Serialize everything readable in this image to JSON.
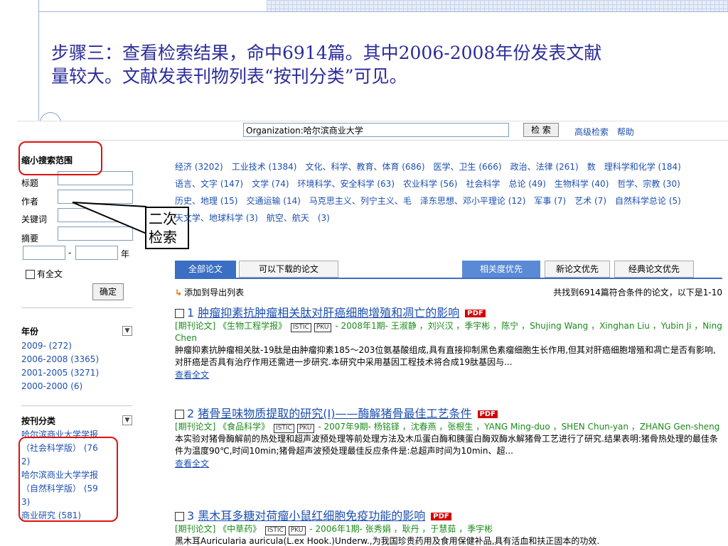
{
  "heading": {
    "line1": "步骤三：查看检索结果，命中6914篇。其中2006-2008年份发表文献",
    "line2": "量较大。文献发表刊物列表“按刊分类”可见。"
  },
  "topbar": {
    "search_value": "Organization:哈尔滨商业大学",
    "search_button": "检 索",
    "links": [
      "高级检索",
      "帮助"
    ]
  },
  "sidebar": {
    "title": "缩小搜索范围",
    "fields": [
      "标题",
      "作者",
      "关键词",
      "摘要"
    ],
    "year_sep": "-",
    "year_suffix": "年",
    "fulltext_label": "有全文",
    "ok_button": "确定",
    "year_facet": {
      "title": "年份",
      "items": [
        "2009- (272)",
        "2006-2008 (3365)",
        "2001-2005 (3271)",
        "2000-2000 (6)"
      ]
    },
    "journal_facet": {
      "title": "按刊分类",
      "items": [
        "哈尔滨商业大学学报",
        "（社会科学版） (76",
        "2)",
        "哈尔滨商业大学学报",
        "（自然科学版） (59",
        "3)",
        "商业研究 (581)"
      ]
    }
  },
  "callout": {
    "line1": "二次",
    "line2": "检索"
  },
  "categories": [
    "经济 (3202)",
    "工业技术 (1384)",
    "文化、科学、教育、体育 (686)",
    "医学、卫生 (666)",
    "政治、法律 (261)",
    "数",
    "理科学和化学 (184)",
    "语言、文字 (147)",
    "文学 (74)",
    "环境科学、安全科学 (63)",
    "农业科学 (56)",
    "社会科学",
    "总论 (49)",
    "生物科学 (40)",
    "哲学、宗教 (30)",
    "历史、地理 (15)",
    "交通运输 (14)",
    "马克思主义、列宁主义、毛",
    "泽东思想、邓小平理论 (12)",
    "军事 (7)",
    "艺术 (7)",
    "自然科学总论 (5)",
    "天文学、地球科学 (3)",
    "航空、航天",
    "(3)"
  ],
  "tabs": {
    "all": "全部论文",
    "downloadable": "可以下载的论文",
    "relevance": "相关度优先",
    "newest": "新论文优先",
    "classic": "经典论文优先"
  },
  "toolbar": {
    "export": "添加到导出列表",
    "found": "共找到6914篇符合条件的论文，以下是1-10"
  },
  "results": [
    {
      "num": "1",
      "title": "肿瘤抑素抗肿瘤相关肽对肝癌细胞增殖和凋亡的影响",
      "pdf": "PDF",
      "meta_pre": "[期刊论文] 《生物工程学报》",
      "badge1": "ISTIC",
      "badge2": "PKU",
      "meta_post": "- 2008年1期- 王淑静 ，刘兴汉 ，季宇彬 ，陈宁 ，Shujing Wang ，Xinghan Liu ，Yubin Ji ，Ning Chen",
      "abstract": "肿瘤抑素抗肿瘤相关肽-19肽是由肿瘤抑素185～203位氨基酸组成,具有直接抑制黑色素瘤细胞生长作用,但其对肝癌细胞增殖和凋亡是否有影响,对肝癌是否具有治疗作用还需进一步研究.本研究中采用基因工程技术将合成19肽基因与...",
      "more": "查看全文"
    },
    {
      "num": "2",
      "title": "猪骨呈味物质提取的研究(Ⅰ)——酶解猪骨最佳工艺条件",
      "pdf": "PDF",
      "meta_pre": "[期刊论文] 《食品科学》",
      "badge1": "ISTIC",
      "badge2": "PKU",
      "meta_post": "- 2007年9期- 杨铭铎 ，沈春燕 ，张根生 ，YANG Ming-duo ，SHEN Chun-yan ，ZHANG Gen-sheng",
      "abstract": "本实验对猪骨酶解前的热处理和超声波预处理等前处理方法及木瓜蛋白酶和胰蛋白酶双酶水解猪骨工艺进行了研究.结果表明:猪骨热处理的最佳条件为温度90℃,时间10min;猪骨超声波预处理最佳反应条件是:总超声时间为10min、超...",
      "more": "查看全文"
    },
    {
      "num": "3",
      "title": "黑木耳多糖对荷瘤小鼠红细胞免疫功能的影响",
      "pdf": "PDF",
      "meta_pre": "[期刊论文] 《中草药》",
      "badge1": "ISTIC",
      "badge2": "PKU",
      "meta_post": "- 2006年1期- 张秀娟 ，耿丹 ，于慧茹 ，季宇彬",
      "abstract": "黑木耳Auricularia auricula(L.ex Hook.)Underw.,为我国珍贵药用及食用保健补品,具有活血和扶正固本的功效.",
      "more": ""
    }
  ]
}
